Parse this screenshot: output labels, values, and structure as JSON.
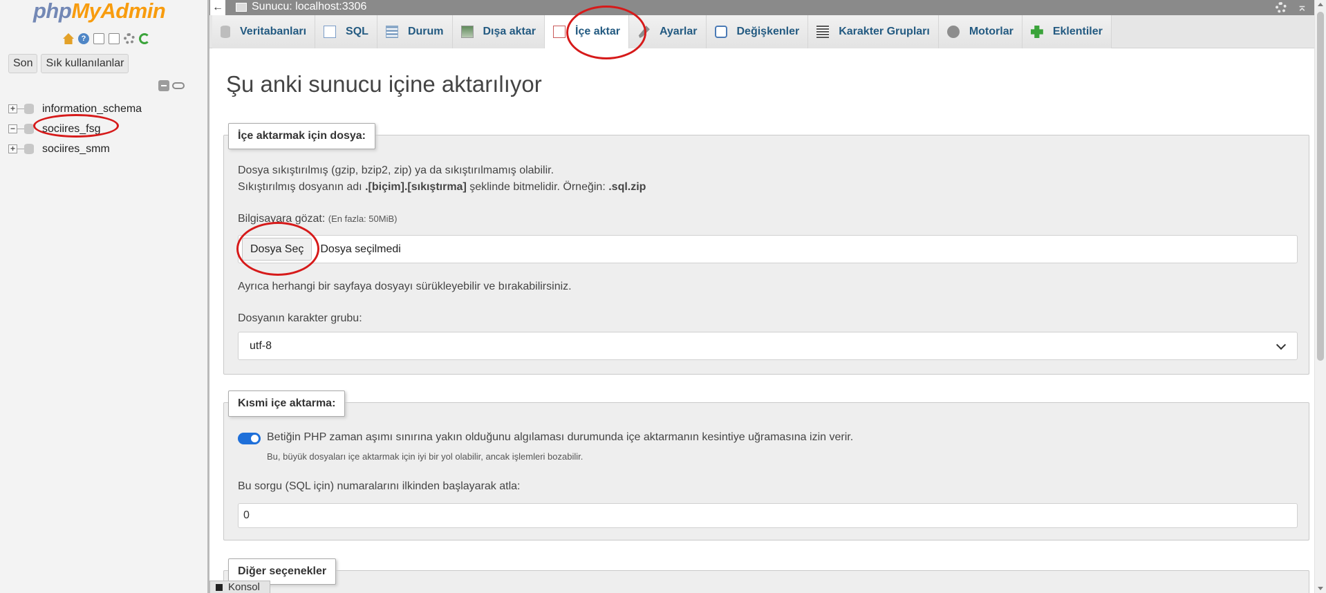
{
  "nav": {
    "logo_php": "php",
    "logo_myadmin": "MyAdmin",
    "recent_label": "Son",
    "favorites_label": "Sık kullanılanlar",
    "databases": [
      "information_schema",
      "sociires_fsg",
      "sociires_smm"
    ]
  },
  "topbar": {
    "server_title": "Sunucu: localhost:3306"
  },
  "tabs": [
    {
      "label": "Veritabanları",
      "icon": "database-icon"
    },
    {
      "label": "SQL",
      "icon": "sql-icon"
    },
    {
      "label": "Durum",
      "icon": "status-icon"
    },
    {
      "label": "Dışa aktar",
      "icon": "export-icon"
    },
    {
      "label": "İçe aktar",
      "icon": "import-icon"
    },
    {
      "label": "Ayarlar",
      "icon": "wrench-icon"
    },
    {
      "label": "Değişkenler",
      "icon": "variables-icon"
    },
    {
      "label": "Karakter Grupları",
      "icon": "charset-icon"
    },
    {
      "label": "Motorlar",
      "icon": "engines-icon"
    },
    {
      "label": "Eklentiler",
      "icon": "plugins-icon"
    }
  ],
  "active_tab": "İçe aktar",
  "main": {
    "page_title": "Şu anki sunucu içine aktarılıyor",
    "file_section": {
      "legend": "İçe aktarmak için dosya:",
      "line1": "Dosya sıkıştırılmış (gzip, bzip2, zip) ya da sıkıştırılmamış olabilir.",
      "line2_a": "Sıkıştırılmış dosyanın adı ",
      "line2_b": ".[biçim].[sıkıştırma]",
      "line2_c": " şeklinde bitmelidir. Örneğin: ",
      "line2_d": ".sql.zip",
      "browse_label": "Bilgisayara gözat:",
      "max_size": "(En fazla: 50MiB)",
      "choose_file": "Dosya Seç",
      "no_file": "Dosya seçilmedi",
      "drag_hint": "Ayrıca herhangi bir sayfaya dosyayı sürükleyebilir ve bırakabilirsiniz.",
      "charset_label": "Dosyanın karakter grubu:",
      "charset_value": "utf-8"
    },
    "partial_section": {
      "legend": "Kısmi içe aktarma:",
      "toggle_on": true,
      "toggle_text": "Betiğin PHP zaman aşımı sınırına yakın olduğunu algılaması durumunda içe aktarmanın kesintiye uğramasına izin verir.",
      "toggle_hint": "Bu, büyük dosyaları içe aktarmak için iyi bir yol olabilir, ancak işlemleri bozabilir.",
      "skip_label": "Bu sorgu (SQL için) numaralarını ilkinden başlayarak atla:",
      "skip_value": "0"
    },
    "other_section": {
      "legend": "Diğer seçenekler"
    }
  },
  "console_label": "Konsol",
  "colors": {
    "tab_text": "#235a81",
    "annotation": "#d61a1a",
    "toggle": "#1e6fd9",
    "logo_php": "#7388b5",
    "logo_myadmin": "#f89c0e"
  }
}
